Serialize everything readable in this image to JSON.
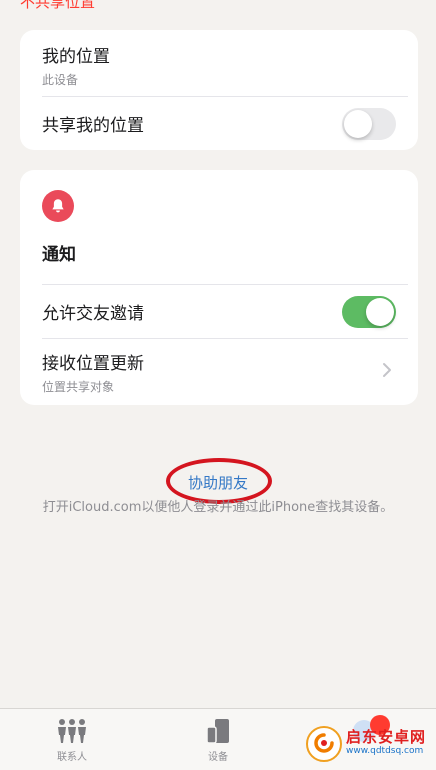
{
  "top_partial_text": "不共享位置",
  "location_card": {
    "my_location_title": "我的位置",
    "my_location_subtitle": "此设备",
    "share_location_label": "共享我的位置",
    "share_location_on": false
  },
  "notifications_card": {
    "icon": "bell-icon",
    "heading": "通知",
    "allow_friend_requests_label": "允许交友邀请",
    "allow_friend_requests_on": true,
    "receive_updates_title": "接收位置更新",
    "receive_updates_subtitle": "位置共享对象"
  },
  "help_friend": {
    "link_label": "协助朋友",
    "description": "打开iCloud.com以便他人登录并通过此iPhone查找其设备。"
  },
  "tabbar": {
    "tabs": [
      {
        "label": "联系人",
        "icon": "people-icon"
      },
      {
        "label": "设备",
        "icon": "devices-icon"
      }
    ]
  },
  "watermark": {
    "name": "启东安卓网",
    "url": "www.qdtdsq.com"
  },
  "colors": {
    "toggle_on": "#5dbb63",
    "link": "#3478c6",
    "bell_bg": "#ea4a5a",
    "annotation_ring": "#d4151f"
  }
}
